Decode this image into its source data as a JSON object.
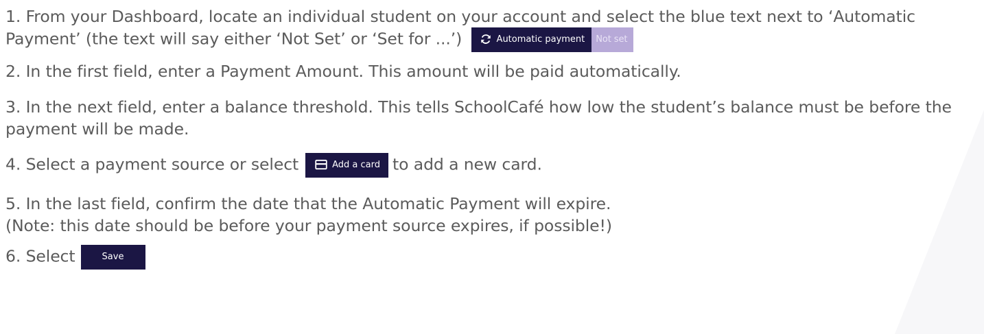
{
  "steps": {
    "s1_text": "1. From your Dashboard, locate an individual student on your account and select the blue text next to ‘Automatic Payment’ (the text will say either ‘Not Set’ or ‘Set for ...’)",
    "s1_button": "Automatic payment",
    "s1_badge": "Not set",
    "s2_text": "2. In the first field, enter a Payment Amount. This amount will be paid automatically.",
    "s3_text": "3. In the next field, enter a balance threshold. This tells SchoolCafé how low the student’s balance must be before the payment will be made.",
    "s4_before": "4. Select a payment source or select",
    "s4_button": "Add a card",
    "s4_after": "to add a new card.",
    "s5_line1": "5. In the last field, confirm the date that the Automatic Payment will expire.",
    "s5_line2": "(Note: this date should be before your payment source expires, if possible!)",
    "s6_before": "6. Select",
    "s6_button": "Save"
  },
  "icons": {
    "automatic_payment": "sync-icon",
    "add_card": "credit-card-icon"
  },
  "colors": {
    "text": "#5b5b5b",
    "button_bg": "#1b1644",
    "badge_bg": "#b7a9d8",
    "badge_text": "#e9e3f6"
  }
}
